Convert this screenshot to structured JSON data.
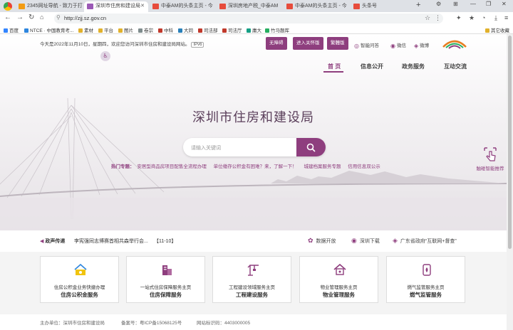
{
  "browser": {
    "tabs": [
      {
        "label": "2345网址导航 - 致力于打",
        "fav": "#f39c12"
      },
      {
        "label": "深圳市住房和建设局",
        "fav": "#9b59b6"
      },
      {
        "label": "中泰AM的头条主页 - 今",
        "fav": "#e74c3c"
      },
      {
        "label": "深圳房地产税_中泰AM",
        "fav": "#e74c3c"
      },
      {
        "label": "中泰AM的头条主页 - 今",
        "fav": "#e74c3c"
      },
      {
        "label": "头条号",
        "fav": "#e74c3c"
      }
    ],
    "url": "http://zjj.sz.gov.cn",
    "bookmarks": [
      "百度",
      "NTCE · 中国教育考...",
      "素材",
      "平台",
      "图片",
      "卷宗",
      "中科",
      "大同",
      "司法部",
      "司法厅",
      "庸大",
      "竹马题库"
    ],
    "other_bookmarks": "其它收藏"
  },
  "header": {
    "greeting": "今天是2022年11月10日，星期四，欢迎您访问深圳市住房和建设局网站。",
    "ipv6": "IPv6",
    "buttons": [
      "无障碍",
      "进入关怀版",
      "繁體版"
    ],
    "tools": [
      "智能问答",
      "微信",
      "微博"
    ],
    "menu": [
      "首 页",
      "信息公开",
      "政务服务",
      "互动交流"
    ]
  },
  "hero": {
    "title": "深圳市住房和建设局",
    "search_placeholder": "请输入关键词",
    "hot_label": "热门专题：",
    "hot_items": [
      "安居型商品房项目配售全流程办理",
      "单位缴存公积金有困难？来，了解一下！",
      "城建档案服务专题",
      "信用信息双公示"
    ],
    "robot_label": "触碰智能推荐"
  },
  "news": {
    "label": "政声传递",
    "headline": "李宪强同志博赛首相共森举行会...",
    "date": "【11-10】",
    "quick": [
      "数据开放",
      "深圳下载",
      "广东省政府“互联网+督查”"
    ]
  },
  "cards": [
    {
      "sub": "住房公积金业务快捷办理",
      "main": "住房公积金服务",
      "icon": "fund-icon"
    },
    {
      "sub": "一站式住房保障服务主页",
      "main": "住房保障服务",
      "icon": "building-icon"
    },
    {
      "sub": "工程建设领域服务主页",
      "main": "工程建设服务",
      "icon": "crane-icon"
    },
    {
      "sub": "物业管理服务主页",
      "main": "物业管理服务",
      "icon": "house-icon"
    },
    {
      "sub": "燃气监管服务主页",
      "main": "燃气监管服务",
      "icon": "gas-icon"
    }
  ],
  "footer": [
    "主办单位：深圳市住房和建设局",
    "备案号：粤ICP备15068125号",
    "网站标识码：4403000005"
  ],
  "colors": {
    "accent": "#8e3e7e"
  }
}
